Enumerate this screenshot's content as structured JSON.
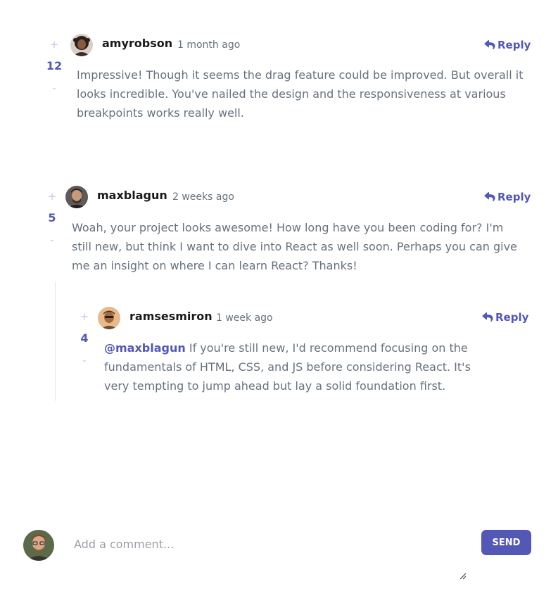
{
  "comments": [
    {
      "username": "amyrobson",
      "timestamp": "1 month ago",
      "score": "12",
      "plus": "+",
      "minus": "-",
      "reply_label": "Reply",
      "content": "Impressive! Though it seems the drag feature could be improved. But overall it looks incredible. You've nailed the design and the responsiveness at various breakpoints works really well."
    },
    {
      "username": "maxblagun",
      "timestamp": "2 weeks ago",
      "score": "5",
      "plus": "+",
      "minus": "-",
      "reply_label": "Reply",
      "content": "Woah, your project looks awesome! How long have you been coding for? I'm still new, but think I want to dive into React as well soon. Perhaps you can give me an insight on where I can learn React? Thanks!",
      "replies": [
        {
          "username": "ramsesmiron",
          "timestamp": "1 week ago",
          "score": "4",
          "plus": "+",
          "minus": "-",
          "reply_label": "Reply",
          "mention": "@maxblagun",
          "content": " If you're still new, I'd recommend focusing on the fundamentals of HTML, CSS, and JS before considering React. It's very tempting to jump ahead but lay a solid foundation first."
        }
      ]
    }
  ],
  "add_comment": {
    "placeholder": "Add a comment...",
    "send_label": "SEND"
  },
  "colors": {
    "accent": "#5357b6",
    "vote_light": "#c5c6ef",
    "text": "#67727e",
    "username": "#1a1a1a"
  },
  "icons": {
    "reply": "reply-arrow-icon",
    "resize": "resize-handle-icon"
  }
}
